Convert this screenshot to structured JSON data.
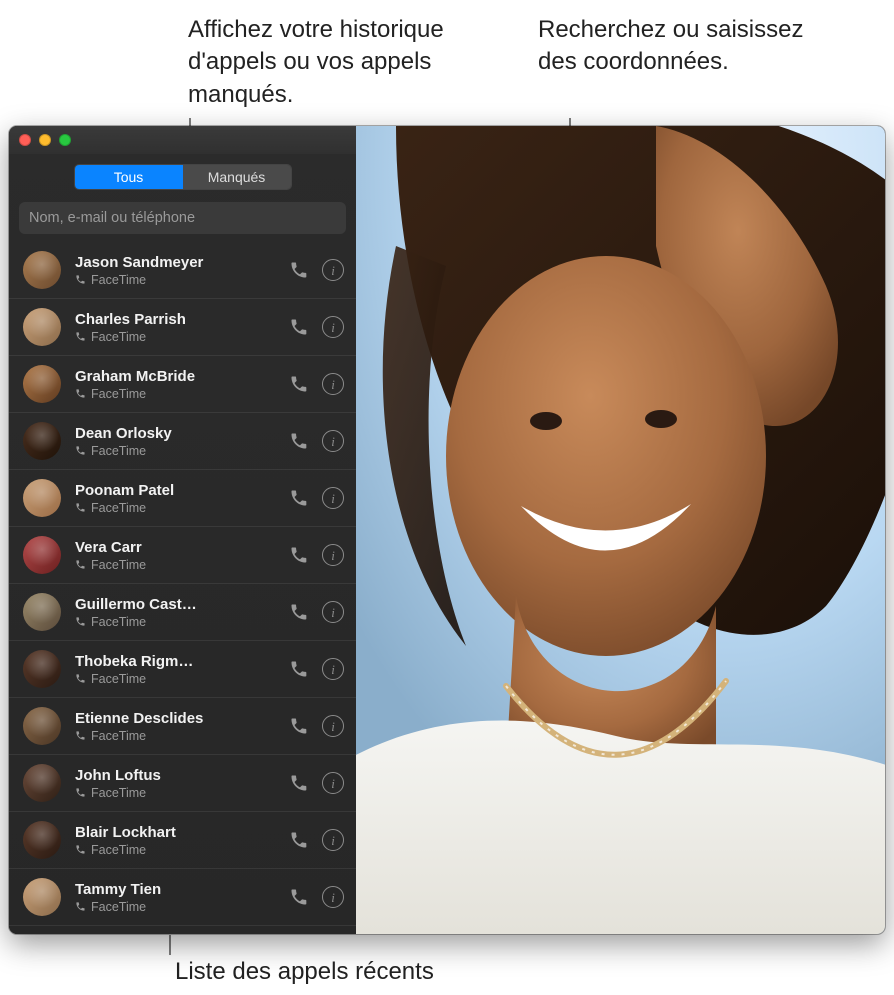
{
  "callouts": {
    "top_left": "Affichez votre historique d'appels ou vos appels manqués.",
    "top_right": "Recherchez ou saisissez des coordonnées.",
    "bottom": "Liste des appels récents"
  },
  "tabs": {
    "all": "Tous",
    "missed": "Manqués"
  },
  "search": {
    "placeholder": "Nom, e-mail ou téléphone"
  },
  "sub_label": "FaceTime",
  "icons": {
    "phone": "phone-icon",
    "info": "info-icon",
    "handset": "handset-icon"
  },
  "contacts": [
    {
      "name": "Jason Sandmeyer"
    },
    {
      "name": "Charles Parrish"
    },
    {
      "name": "Graham McBride"
    },
    {
      "name": "Dean Orlosky"
    },
    {
      "name": "Poonam Patel"
    },
    {
      "name": "Vera Carr"
    },
    {
      "name": "Guillermo Cast…"
    },
    {
      "name": "Thobeka Rigm…"
    },
    {
      "name": "Etienne Desclides"
    },
    {
      "name": "John Loftus"
    },
    {
      "name": "Blair Lockhart"
    },
    {
      "name": "Tammy Tien"
    }
  ]
}
